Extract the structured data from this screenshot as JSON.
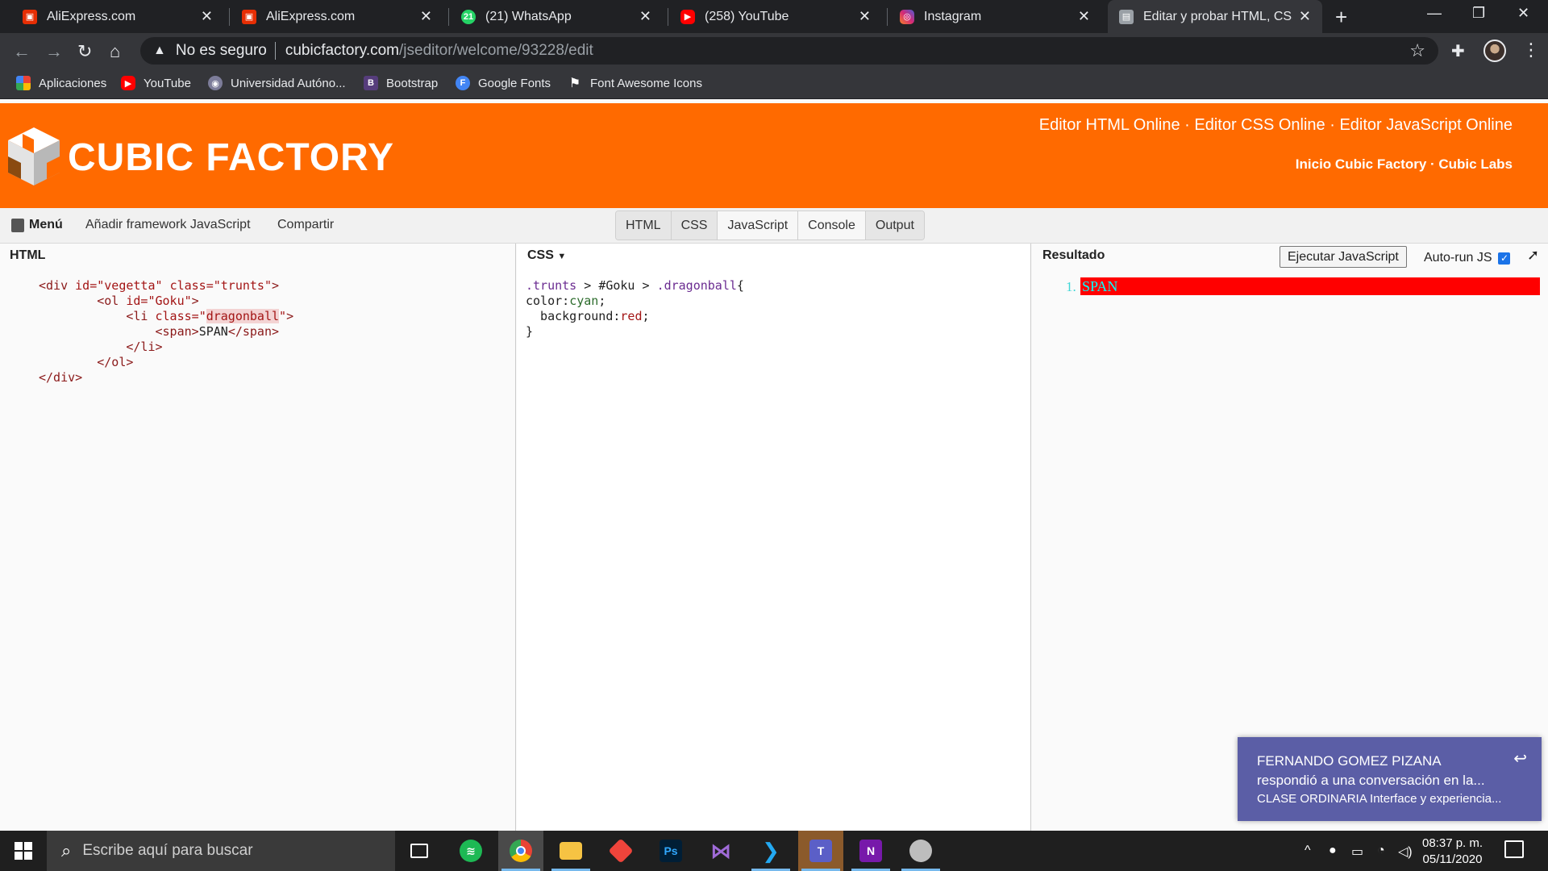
{
  "browser": {
    "tabs": [
      {
        "title": "AliExpress.com",
        "favicon_color": "#e62e04"
      },
      {
        "title": "AliExpress.com",
        "favicon_color": "#e62e04"
      },
      {
        "title": "(21) WhatsApp",
        "favicon_color": "#25d366",
        "badge": "21"
      },
      {
        "title": "(258) YouTube",
        "favicon_color": "#ff0000"
      },
      {
        "title": "Instagram",
        "favicon_color": "#d62976"
      },
      {
        "title": "Editar y probar HTML, CSS y",
        "favicon_color": "#9aa0a6"
      }
    ],
    "address": {
      "security_label": "No es seguro",
      "host": "cubicfactory.com",
      "path": "/jseditor/welcome/93228/edit"
    },
    "bookmarks": [
      {
        "label": "Aplicaciones",
        "icon": "apps-grid-icon"
      },
      {
        "label": "YouTube",
        "icon": "youtube-icon"
      },
      {
        "label": "Universidad Autóno...",
        "icon": "university-icon"
      },
      {
        "label": "Bootstrap",
        "icon": "bootstrap-icon",
        "glyph": "B"
      },
      {
        "label": "Google Fonts",
        "icon": "google-fonts-icon",
        "glyph": "F"
      },
      {
        "label": "Font Awesome Icons",
        "icon": "flag-icon"
      }
    ]
  },
  "site": {
    "logo_text": "CUBIC FACTORY",
    "header_links": "Editor HTML Online · Editor CSS Online · Editor JavaScript Online",
    "header_sub": "Inicio Cubic Factory · Cubic Labs",
    "brand_color": "#ff6a00"
  },
  "menubar": {
    "menu": "Menú",
    "add_framework": "Añadir framework JavaScript",
    "share": "Compartir",
    "view_tabs": [
      "HTML",
      "CSS",
      "JavaScript",
      "Console",
      "Output"
    ]
  },
  "html_pane": {
    "title": "HTML",
    "code": {
      "l1a": "<div ",
      "l1b": "id=",
      "l1c": "\"vegetta\" ",
      "l1d": "class=",
      "l1e": "\"trunts\"",
      "l1f": ">",
      "l2a": "<ol ",
      "l2b": "id=",
      "l2c": "\"Goku\"",
      "l2d": ">",
      "l3a": "<li ",
      "l3b": "class=",
      "l3c": "\"",
      "l3d": "dragonball",
      "l3e": "\"",
      "l3f": ">",
      "l4a": "<span>",
      "l4b": "SPAN",
      "l4c": "</span>",
      "l5": "</li>",
      "l6": "</ol>",
      "l7": "</div>"
    }
  },
  "css_pane": {
    "title": "CSS",
    "code": {
      "s1": ".trunts",
      "s2": " > ",
      "s3": "#Goku",
      "s4": " > ",
      "s5": ".dragonball",
      "s6": "{",
      "p1": "color:",
      "v1": "cyan",
      "e1": ";",
      "p2": "  background:",
      "v2": "red",
      "e2": ";",
      "close": "}"
    }
  },
  "result_pane": {
    "title": "Resultado",
    "run_button": "Ejecutar JavaScript",
    "autorun_label": "Auto-run JS",
    "list_number": "1.",
    "span_text": "SPAN"
  },
  "notification": {
    "sender": "FERNANDO GOMEZ PIZANA",
    "line2": "respondió a una conversación en la...",
    "line3": "CLASE ORDINARIA Interface y experiencia..."
  },
  "taskbar": {
    "search_placeholder": "Escribe aquí para buscar",
    "time": "08:37 p. m.",
    "date": "05/11/2020"
  }
}
